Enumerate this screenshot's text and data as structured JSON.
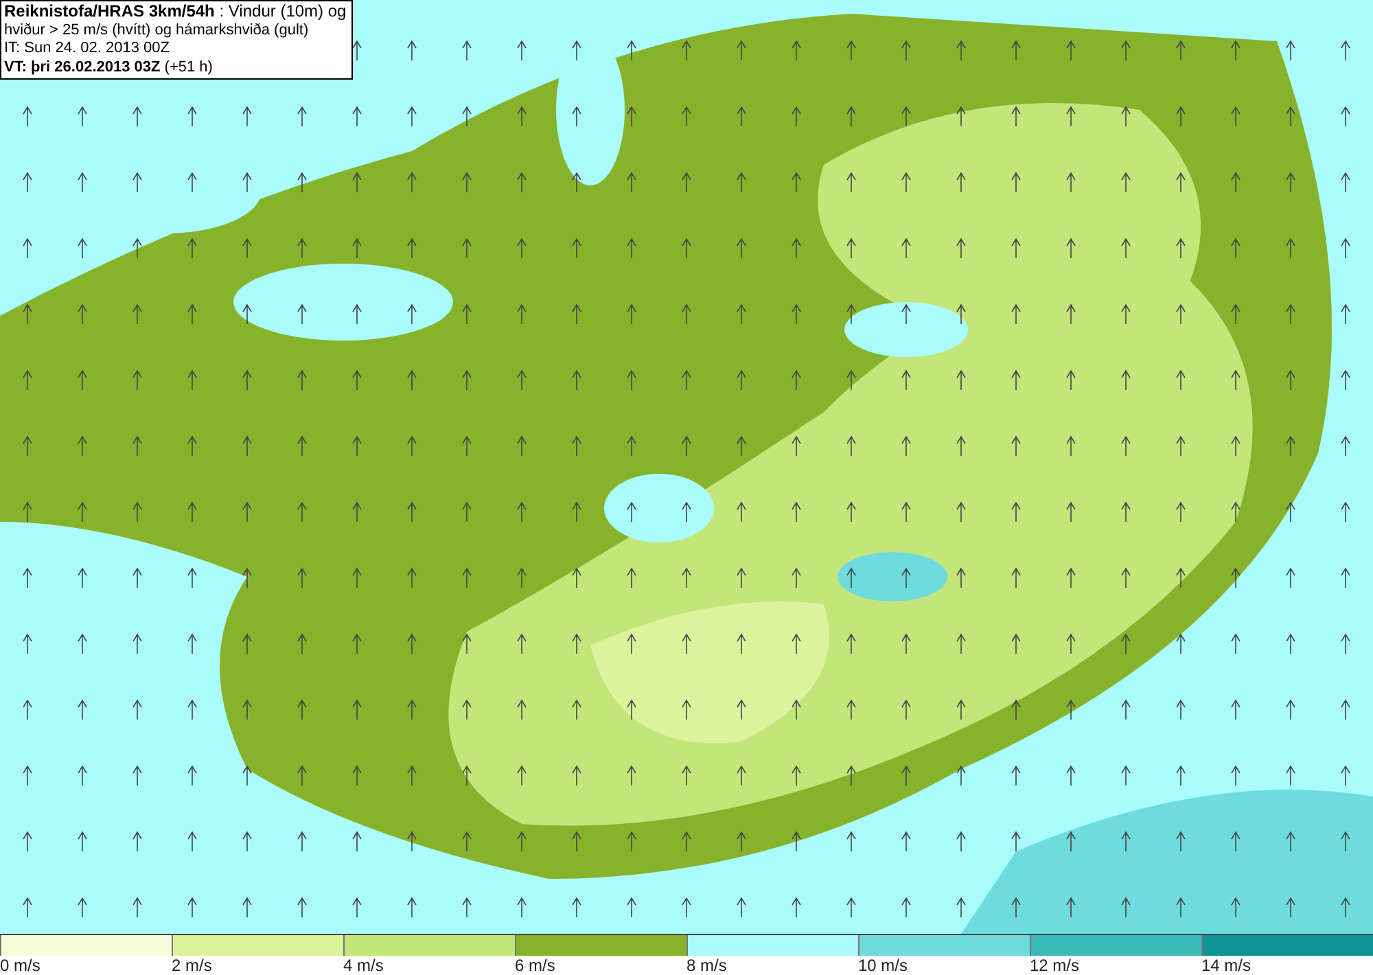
{
  "info_box": {
    "lines": [
      "**Reiknistofa/HRAS 3km/54h** : Vindur (10m) og",
      "hviður > 25 m/s (hvítt) og hámarkshviða (gult)",
      "IT: Sun 24. 02. 2013 00Z",
      "**VT: þri 26.02.2013 03Z** (+51 h)"
    ]
  },
  "legend": [
    {
      "label": "0 m/s",
      "color": "#f5fcda"
    },
    {
      "label": "2 m/s",
      "color": "#dcf29c"
    },
    {
      "label": "4 m/s",
      "color": "#c2e67a"
    },
    {
      "label": "6 m/s",
      "color": "#86b22c"
    },
    {
      "label": "8 m/s",
      "color": "#aafcfc"
    },
    {
      "label": "10 m/s",
      "color": "#6edcdc"
    },
    {
      "label": "12 m/s",
      "color": "#3cbaba"
    },
    {
      "label": "14 m/s",
      "color": "#0e9494"
    }
  ]
}
